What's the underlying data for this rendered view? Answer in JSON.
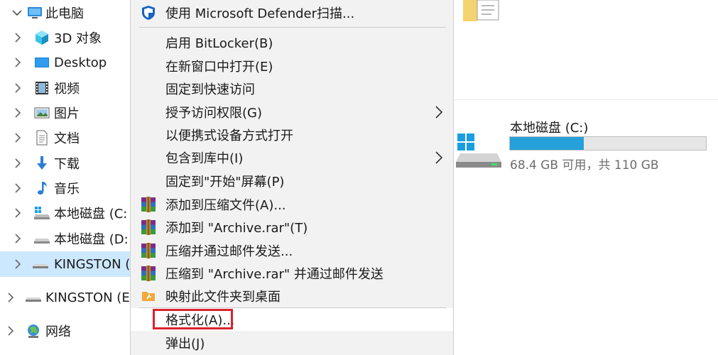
{
  "nav": {
    "items": [
      {
        "label": "此电脑",
        "icon": "computer-icon",
        "expanded": true
      },
      {
        "label": "3D 对象",
        "icon": "3d-objects-icon"
      },
      {
        "label": "Desktop",
        "icon": "desktop-icon"
      },
      {
        "label": "视频",
        "icon": "videos-icon"
      },
      {
        "label": "图片",
        "icon": "pictures-icon"
      },
      {
        "label": "文档",
        "icon": "documents-icon"
      },
      {
        "label": "下载",
        "icon": "downloads-icon"
      },
      {
        "label": "音乐",
        "icon": "music-icon"
      },
      {
        "label": "本地磁盘 (C:)",
        "icon": "drive-icon"
      },
      {
        "label": "本地磁盘 (D:)",
        "icon": "drive-icon"
      },
      {
        "label": "KINGSTON (E:)",
        "icon": "usb-drive-icon",
        "selected": true
      },
      {
        "label": "KINGSTON (E:)",
        "icon": "usb-drive-icon"
      },
      {
        "label": "网络",
        "icon": "network-icon"
      }
    ]
  },
  "content": {
    "drive": {
      "name": "本地磁盘 (C:)",
      "space_text": "68.4 GB 可用，共 110 GB",
      "free_gb": 68.4,
      "total_gb": 110,
      "icon": "windows-drive-icon"
    }
  },
  "menu": {
    "items": [
      {
        "label": "使用 Microsoft Defender扫描...",
        "icon": "defender-shield-icon"
      },
      {
        "label": "启用 BitLocker(B)"
      },
      {
        "label": "在新窗口中打开(E)"
      },
      {
        "label": "固定到快速访问"
      },
      {
        "label": "授予访问权限(G)",
        "submenu": true
      },
      {
        "label": "以便携式设备方式打开"
      },
      {
        "label": "包含到库中(I)",
        "submenu": true
      },
      {
        "label": "固定到\"开始\"屏幕(P)"
      },
      {
        "label": "添加到压缩文件(A)...",
        "icon": "winrar-icon"
      },
      {
        "label": "添加到 \"Archive.rar\"(T)",
        "icon": "winrar-icon"
      },
      {
        "label": "压缩并通过邮件发送...",
        "icon": "winrar-icon"
      },
      {
        "label": "压缩到 \"Archive.rar\" 并通过邮件发送",
        "icon": "winrar-icon"
      },
      {
        "label": "映射此文件夹到桌面",
        "icon": "folder-shortcut-icon"
      },
      {
        "label": "格式化(A)...",
        "highlighted": true
      },
      {
        "label": "弹出(J)"
      }
    ]
  },
  "colors": {
    "selection": "#cce8ff",
    "menu_bg": "#f2f2f2",
    "drive_bar_fill": "#26a0da",
    "callout_red": "#d9232e"
  }
}
